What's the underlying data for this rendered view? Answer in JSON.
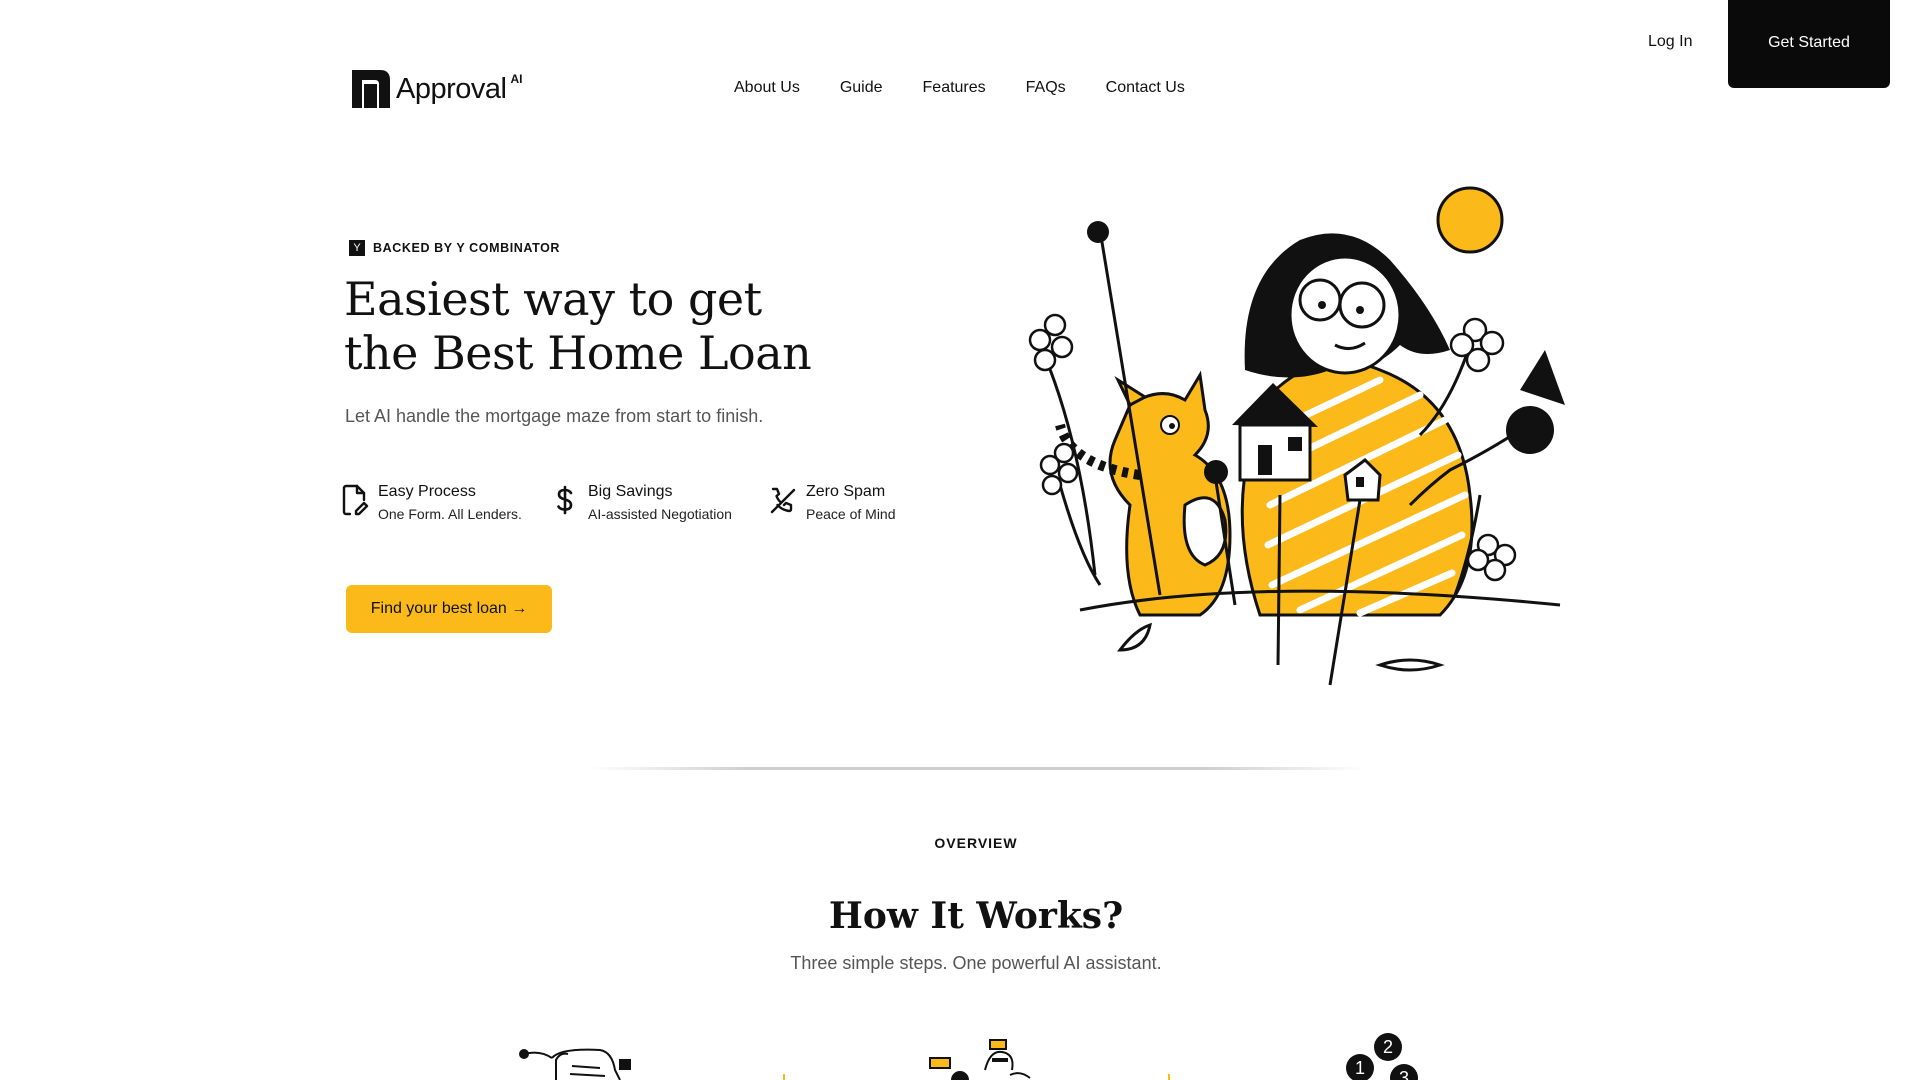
{
  "header": {
    "logo_text": "Approval",
    "logo_suffix": "AI",
    "login_label": "Log In",
    "get_started_label": "Get Started"
  },
  "nav": {
    "items": [
      {
        "label": "About Us"
      },
      {
        "label": "Guide"
      },
      {
        "label": "Features"
      },
      {
        "label": "FAQs"
      },
      {
        "label": "Contact Us"
      }
    ]
  },
  "hero": {
    "yc_logo": "Y",
    "badge": "BACKED BY Y COMBINATOR",
    "title_line1": "Easiest way to get",
    "title_line2": "the Best Home Loan",
    "subtitle": "Let AI handle the mortgage maze from start to finish.",
    "features": [
      {
        "icon": "document-edit-icon",
        "title": "Easy Process",
        "desc": "One Form. All Lenders."
      },
      {
        "icon": "dollar-icon",
        "title": "Big Savings",
        "desc": "AI-assisted Negotiation"
      },
      {
        "icon": "phone-off-icon",
        "title": "Zero Spam",
        "desc": "Peace of Mind"
      }
    ],
    "cta_label": "Find your best loan →"
  },
  "overview": {
    "eyebrow": "OVERVIEW",
    "title": "How It Works?",
    "subtitle": "Three simple steps. One powerful AI assistant.",
    "step_numbers": [
      "1",
      "2",
      "3"
    ]
  },
  "colors": {
    "accent": "#fbb91a",
    "dark": "#0a0a0a",
    "muted_text": "#555555"
  }
}
